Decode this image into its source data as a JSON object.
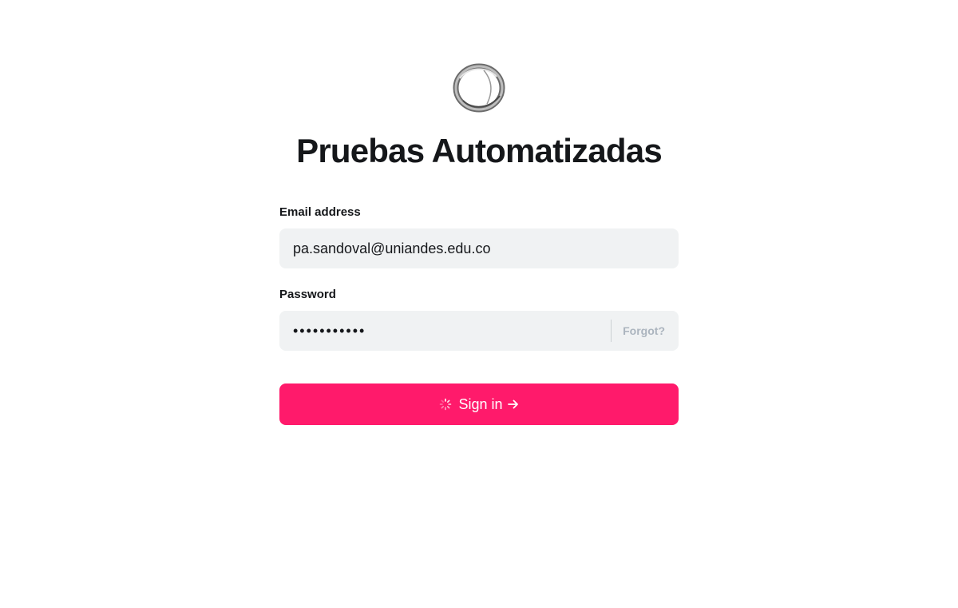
{
  "site": {
    "title": "Pruebas Automatizadas",
    "logo_icon": "ring-logo-icon"
  },
  "form": {
    "email": {
      "label": "Email address",
      "value": "pa.sandoval@uniandes.edu.co",
      "placeholder": ""
    },
    "password": {
      "label": "Password",
      "value": "•••••••••••",
      "forgot_label": "Forgot?"
    },
    "submit": {
      "label": "Sign in",
      "loading_icon": "spinner-icon",
      "arrow_icon": "arrow-right-icon"
    }
  },
  "colors": {
    "accent": "#ff1a6b",
    "input_background": "#f0f2f3",
    "text": "#15171a",
    "muted": "#abb4be"
  }
}
